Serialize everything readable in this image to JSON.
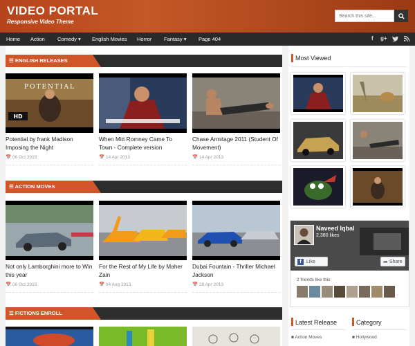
{
  "header": {
    "title": "VIDEO PORTAL",
    "tagline": "Responsive Video Theme",
    "search_placeholder": "Search this site...",
    "accent": "#d0562a"
  },
  "nav": {
    "items": [
      "Home",
      "Action",
      "Comedy ▾",
      "English Movies",
      "Horror",
      "Fantasy ▾",
      "Page 404"
    ],
    "social_icons": [
      "facebook-icon",
      "google-plus-icon",
      "twitter-icon",
      "rss-icon"
    ]
  },
  "sections": [
    {
      "title": "ENGLISH RELEASES",
      "posts": [
        {
          "title": "Potential by frank Madison Imposing the Night",
          "date": "06 Oct 2015",
          "overlay": "POTENTIAL"
        },
        {
          "title": "When Mitt Romney Came To Town - Complete version",
          "date": "14 Apr 2013"
        },
        {
          "title": "Chase Armitage 2011 (Student Of Movement)",
          "date": "14 Apr 2013"
        }
      ]
    },
    {
      "title": "ACTION MOVES",
      "posts": [
        {
          "title": "Not only Lamborghini more to Win this year",
          "date": "06 Oct 2015"
        },
        {
          "title": "For the Rest of My Life by Maher Zain",
          "date": "04 Aug 2013"
        },
        {
          "title": "Dubai Fountain - Thriller Michael Jackson",
          "date": "28 Apr 2013"
        }
      ]
    },
    {
      "title": "FICTIONS ENROLL",
      "posts": []
    }
  ],
  "sidebar": {
    "most_viewed": "Most Viewed",
    "facebook": {
      "name": "Naveed Iqbal",
      "likes": "2,380 likes",
      "like_button": "Like Page",
      "share_button": "Share",
      "friends_text": "2 friends like this"
    },
    "latest_release": {
      "title": "Latest Release",
      "first_item": "Action Moves"
    },
    "category": {
      "title": "Category",
      "first_item": "Hollywood"
    }
  }
}
